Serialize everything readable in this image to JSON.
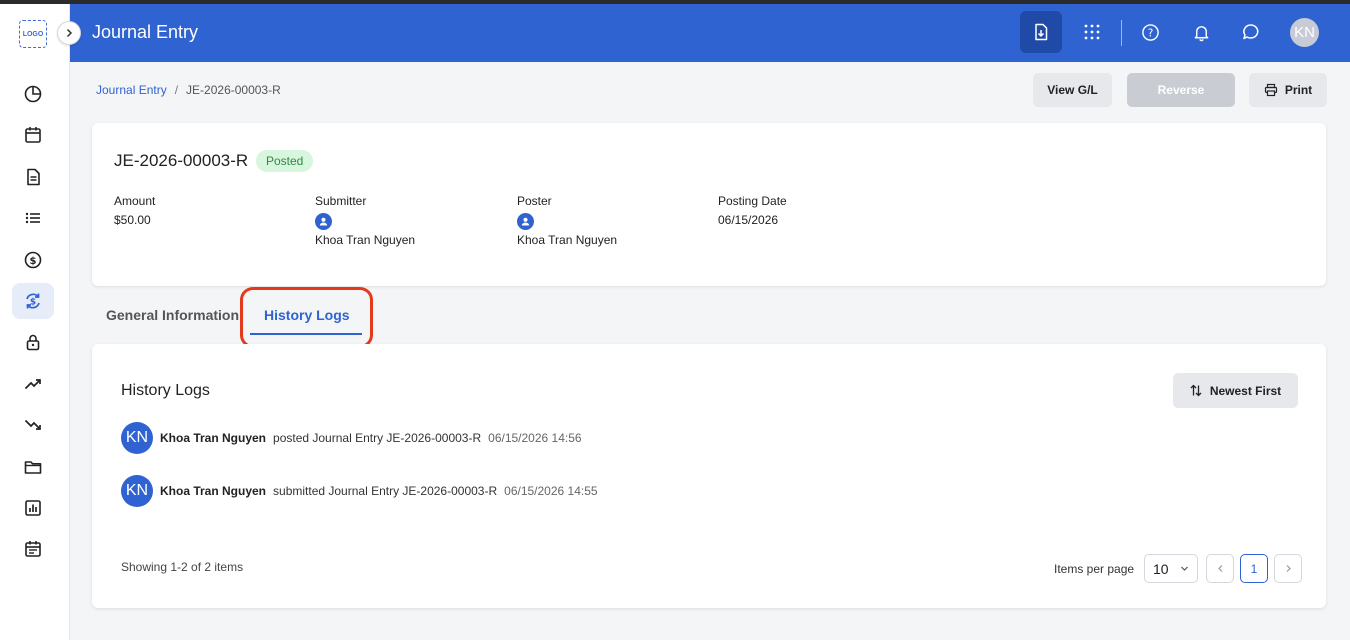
{
  "sidebar": {
    "logo_text": "LOGO",
    "expand_icon": "chevron-right-icon",
    "items": [
      {
        "icon": "pie-chart-icon",
        "active": false
      },
      {
        "icon": "calendar-icon",
        "active": false
      },
      {
        "icon": "document-icon",
        "active": false
      },
      {
        "icon": "list-icon",
        "active": false
      },
      {
        "icon": "dollar-circle-icon",
        "active": false
      },
      {
        "icon": "exchange-dollar-icon",
        "active": true
      },
      {
        "icon": "lock-icon",
        "active": false
      },
      {
        "icon": "trending-up-icon",
        "active": false
      },
      {
        "icon": "trending-down-icon",
        "active": false
      },
      {
        "icon": "folder-icon",
        "active": false
      },
      {
        "icon": "bar-report-icon",
        "active": false
      },
      {
        "icon": "schedule-icon",
        "active": false
      }
    ]
  },
  "header": {
    "title": "Journal Entry",
    "avatar_initials": "KN",
    "icons": [
      "download-doc-icon",
      "apps-grid-icon",
      "help-icon",
      "bell-icon",
      "chat-icon"
    ]
  },
  "breadcrumb": {
    "parent": "Journal Entry",
    "separator": "/",
    "current": "JE-2026-00003-R"
  },
  "actions": {
    "view_gl": "View G/L",
    "reverse": "Reverse",
    "print": "Print"
  },
  "summary": {
    "id": "JE-2026-00003-R",
    "status": "Posted",
    "amount_label": "Amount",
    "amount_value": "$50.00",
    "submitter_label": "Submitter",
    "submitter_value": "Khoa Tran Nguyen",
    "poster_label": "Poster",
    "poster_value": "Khoa Tran Nguyen",
    "posting_date_label": "Posting Date",
    "posting_date_value": "06/15/2026"
  },
  "tabs": {
    "general": "General Information",
    "history": "History Logs"
  },
  "history": {
    "title": "History Logs",
    "sort_label": "Newest First",
    "logs": [
      {
        "initials": "KN",
        "user": "Khoa Tran Nguyen",
        "action": "posted Journal Entry JE-2026-00003-R",
        "time": "06/15/2026 14:56"
      },
      {
        "initials": "KN",
        "user": "Khoa Tran Nguyen",
        "action": "submitted Journal Entry JE-2026-00003-R",
        "time": "06/15/2026 14:55"
      }
    ],
    "showing": "Showing 1-2 of 2 items",
    "items_per_page_label": "Items per page",
    "items_per_page_value": "10",
    "current_page": "1"
  },
  "colors": {
    "primary": "#2f63d1",
    "highlight": "#e33a1e",
    "posted_bg": "#d8f5dd",
    "posted_fg": "#2e8a44"
  }
}
